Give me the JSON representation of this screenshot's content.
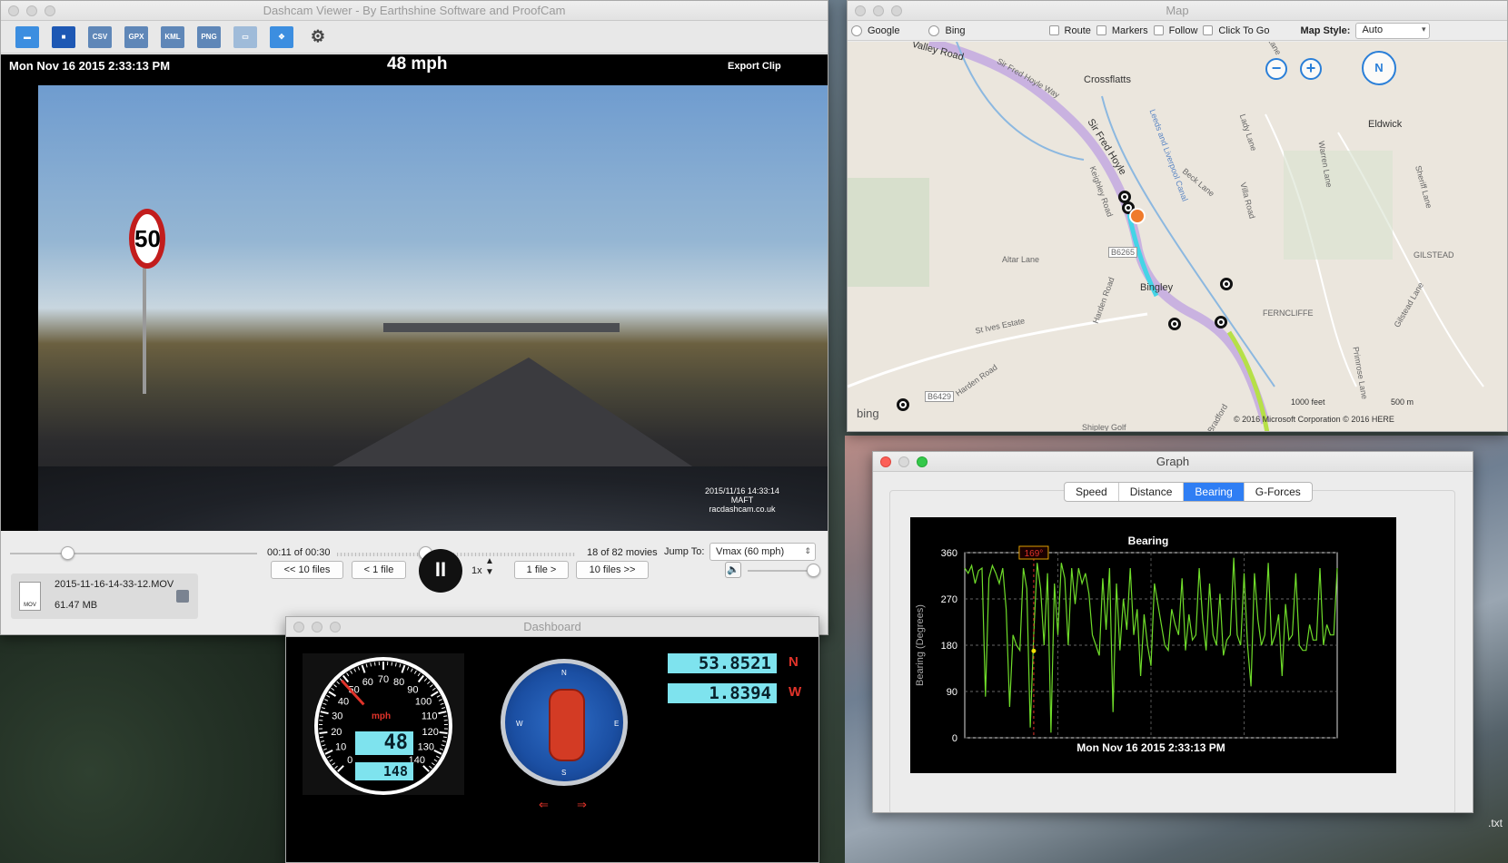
{
  "desktop": {
    "file_label": ".txt"
  },
  "main": {
    "title": "Dashcam Viewer - By Earthshine Software and ProofCam",
    "toolbar": [
      "open-icon",
      "window-icon",
      "csv-export-icon",
      "gpx-export-icon",
      "kml-export-icon",
      "png-export-icon",
      "layout-icon",
      "fullscreen-icon",
      "settings-icon"
    ],
    "toolbar_text": {
      "csv": "CSV",
      "gpx": "GPX",
      "kml": "KML",
      "png": "PNG"
    },
    "overlay": {
      "datetime": "Mon Nov 16 2015   2:33:13 PM",
      "speed": "48 mph",
      "export": "Export Clip"
    },
    "video": {
      "sign": "50",
      "stamp_line1": "2015/11/16 14:33:14",
      "stamp_line2": "MAFT",
      "stamp_line3": "racdashcam.co.uk"
    },
    "controls": {
      "time": "00:11 of 00:30",
      "movie_count": "18 of 82 movies",
      "jump_label": "Jump To:",
      "jump_value": "Vmax (60 mph)",
      "file_name": "2015-11-16-14-33-12.MOV",
      "file_size": "61.47 MB",
      "file_icon_text": "MOV",
      "prev10": "<< 10 files",
      "prev1": "< 1 file",
      "next1": "1 file >",
      "next10": "10 files >>",
      "rate": "1x",
      "play_glyph": "II",
      "seek_fraction": 0.37,
      "video_position_fraction": 0.23,
      "volume_fraction": 1.0
    }
  },
  "map": {
    "title": "Map",
    "providers": [
      "Google",
      "Bing"
    ],
    "options": [
      "Route",
      "Markers",
      "Follow",
      "Click To Go"
    ],
    "style_label": "Map Style:",
    "style_value": "Auto",
    "places": {
      "crossflatts": "Crossflatts",
      "eldwick": "Eldwick",
      "bingley": "Bingley",
      "gilstead": "GILSTEAD",
      "ferncliffe": "FERNCLIFFE",
      "altar": "Altar Lane",
      "stives": "St Ives Estate",
      "harden": "Harden Road",
      "valley": "Valley Road",
      "sirfred": "Sir Fred Hoyle Way",
      "sirfred2": "Sir Fred Hoyle",
      "keighley": "Keighley Road",
      "beck": "Beck Lane",
      "villa": "Villa Road",
      "warren": "Warren Lane",
      "lady": "Lady Lane",
      "primrose": "Primrose Lane",
      "b6265": "B6265",
      "b6429": "B6429",
      "canal": "Leeds and Liverpool Canal",
      "gilstead_lane": "Gilstead Lane",
      "harden2": "Harden Road",
      "sheriff": "Sheriff Lane",
      "bradford": "Bradford",
      "shipley": "Shipley Golf",
      "nlane": "Lane"
    },
    "scale_feet": "1000 feet",
    "scale_m": "500 m",
    "copyright": "© 2016 Microsoft Corporation   © 2016 HERE",
    "bing": "bing",
    "compass_n": "N"
  },
  "dashboard": {
    "title": "Dashboard",
    "speed_unit": "mph",
    "speed_lcd": "48",
    "odometer_lcd": "148",
    "gauge_ticks": [
      "0",
      "10",
      "20",
      "30",
      "40",
      "50",
      "60",
      "70",
      "80",
      "90",
      "100",
      "110",
      "120",
      "130",
      "140"
    ],
    "speed_value": 48,
    "lat": "53.8521",
    "lat_dir": "N",
    "lon": "1.8394",
    "lon_dir": "W",
    "compass_letters": {
      "n": "N",
      "s": "S",
      "e": "E",
      "w": "W"
    },
    "indicator_left": "⇐",
    "indicator_right": "⇒"
  },
  "graph": {
    "title": "Graph",
    "tabs": [
      "Speed",
      "Distance",
      "Bearing",
      "G-Forces"
    ],
    "active_tab": "Bearing",
    "cursor_label": "169°",
    "x_label": "Mon Nov 16 2015   2:33:13 PM",
    "chart_data": {
      "type": "line",
      "title": "Bearing",
      "ylabel": "Bearing (Degrees)",
      "xlabel": "",
      "ylim": [
        0,
        360
      ],
      "yticks": [
        "0",
        "90",
        "180",
        "270",
        "360"
      ],
      "grid": true,
      "colors": {
        "line": "#6fdc2a",
        "cursor": "#e0332a",
        "cursor_point": "#f0e000"
      },
      "series": [
        {
          "name": "",
          "values": [
            330,
            320,
            335,
            300,
            325,
            330,
            80,
            310,
            335,
            320,
            300,
            330,
            250,
            60,
            200,
            180,
            170,
            330,
            290,
            20,
            200,
            340,
            290,
            180,
            320,
            10,
            300,
            200,
            340,
            310,
            180,
            330,
            260,
            330,
            300,
            320,
            280,
            200,
            180,
            160,
            310,
            210,
            330,
            50,
            300,
            170,
            270,
            210,
            330,
            200,
            250,
            120,
            240,
            180,
            140,
            300,
            260,
            220,
            180,
            170,
            250,
            220,
            200,
            310,
            170,
            240,
            190,
            200,
            330,
            230,
            170,
            300,
            200,
            180,
            280,
            160,
            190,
            200,
            350,
            200,
            180,
            320,
            180,
            100,
            320,
            230,
            180,
            200,
            340,
            180,
            200,
            240,
            120,
            260,
            190,
            200,
            320,
            180,
            170,
            170,
            220,
            190,
            190,
            330,
            180,
            220,
            200,
            200,
            330
          ]
        }
      ],
      "cursor_index": 20,
      "cursor_value": 169
    }
  }
}
